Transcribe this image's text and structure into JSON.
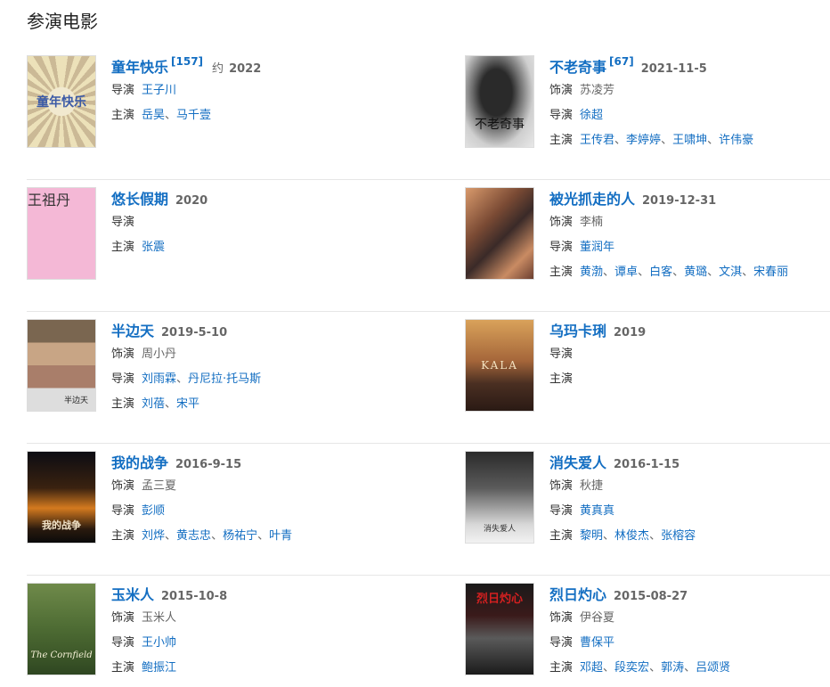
{
  "section_title": "参演电影",
  "labels": {
    "role": "饰演",
    "director": "导演",
    "stars": "主演"
  },
  "movies": [
    {
      "title": "童年快乐",
      "cite": "[157]",
      "year_prefix": "约",
      "year": "2022",
      "poster_text": "童年快乐",
      "poster_style": "p-tongnian",
      "role": null,
      "director": [
        "王子川"
      ],
      "stars": [
        "岳昊",
        "马千壹"
      ]
    },
    {
      "title": "不老奇事",
      "cite": "[67]",
      "year_prefix": "",
      "year": "2021-11-5",
      "poster_text": "不老奇事",
      "poster_style": "p-bulao",
      "role": "苏凌芳",
      "director": [
        "徐超"
      ],
      "stars": [
        "王传君",
        "李婷婷",
        "王啸坤",
        "许伟豪"
      ]
    },
    {
      "title": "悠长假期",
      "cite": "",
      "year_prefix": "",
      "year": "2020",
      "poster_text": "王祖丹",
      "poster_style": "p-youchang",
      "role": null,
      "director": [],
      "stars": [
        "张震"
      ]
    },
    {
      "title": "被光抓走的人",
      "cite": "",
      "year_prefix": "",
      "year": "2019-12-31",
      "poster_text": "",
      "poster_style": "p-beiguang",
      "role": "李楠",
      "director": [
        "董润年"
      ],
      "stars": [
        "黄渤",
        "谭卓",
        "白客",
        "黄璐",
        "文淇",
        "宋春丽"
      ]
    },
    {
      "title": "半边天",
      "cite": "",
      "year_prefix": "",
      "year": "2019-5-10",
      "poster_text": "半边天",
      "poster_style": "p-banbian",
      "role": "周小丹",
      "director": [
        "刘雨霖",
        "丹尼拉·托马斯"
      ],
      "stars": [
        "刘蓓",
        "宋平"
      ]
    },
    {
      "title": "乌玛卡琍",
      "cite": "",
      "year_prefix": "",
      "year": "2019",
      "poster_text": "KALA",
      "poster_style": "p-wuma",
      "role": null,
      "director": [],
      "stars": []
    },
    {
      "title": "我的战争",
      "cite": "",
      "year_prefix": "",
      "year": "2016-9-15",
      "poster_text": "我的战争",
      "poster_style": "p-zhanzheng",
      "role": "孟三夏",
      "director": [
        "彭顺"
      ],
      "stars": [
        "刘烨",
        "黄志忠",
        "杨祐宁",
        "叶青"
      ]
    },
    {
      "title": "消失爱人",
      "cite": "",
      "year_prefix": "",
      "year": "2016-1-15",
      "poster_text": "消失爱人",
      "poster_style": "p-xiaoshi",
      "role": "秋捷",
      "director": [
        "黄真真"
      ],
      "stars": [
        "黎明",
        "林俊杰",
        "张榕容"
      ]
    },
    {
      "title": "玉米人",
      "cite": "",
      "year_prefix": "",
      "year": "2015-10-8",
      "poster_text": "The Cornfield",
      "poster_style": "p-yumi",
      "role": "玉米人",
      "director": [
        "王小帅"
      ],
      "stars": [
        "鲍振江"
      ]
    },
    {
      "title": "烈日灼心",
      "cite": "",
      "year_prefix": "",
      "year": "2015-08-27",
      "poster_text": "烈日灼心",
      "poster_style": "p-lieri",
      "role": "伊谷夏",
      "director": [
        "曹保平"
      ],
      "stars": [
        "邓超",
        "段奕宏",
        "郭涛",
        "吕颂贤"
      ]
    }
  ]
}
